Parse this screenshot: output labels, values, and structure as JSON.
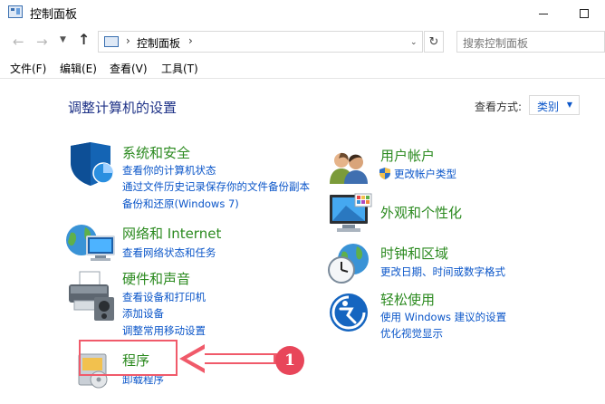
{
  "window": {
    "title": "控制面板",
    "minimize_glyph": "",
    "maximize_glyph": ""
  },
  "address_bar": {
    "path": "控制面板",
    "separator": "›",
    "search_placeholder": "搜索控制面板"
  },
  "menu": {
    "file": "文件(F)",
    "edit": "编辑(E)",
    "view": "查看(V)",
    "tools": "工具(T)"
  },
  "page": {
    "heading": "调整计算机的设置",
    "view_by_label": "查看方式:",
    "view_by_value": "类别"
  },
  "categories": {
    "security": {
      "title": "系统和安全",
      "links": [
        "查看你的计算机状态",
        "通过文件历史记录保存你的文件备份副本",
        "备份和还原(Windows 7)"
      ]
    },
    "network": {
      "title": "网络和 Internet",
      "links": [
        "查看网络状态和任务"
      ]
    },
    "hardware": {
      "title": "硬件和声音",
      "links": [
        "查看设备和打印机",
        "添加设备",
        "调整常用移动设置"
      ]
    },
    "programs": {
      "title": "程序",
      "links": [
        "卸载程序"
      ]
    },
    "users": {
      "title": "用户帐户",
      "links": [
        "更改帐户类型"
      ]
    },
    "appearance": {
      "title": "外观和个性化",
      "links": []
    },
    "clock": {
      "title": "时钟和区域",
      "links": [
        "更改日期、时间或数字格式"
      ]
    },
    "ease": {
      "title": "轻松使用",
      "links": [
        "使用 Windows 建议的设置",
        "优化视觉显示"
      ]
    }
  },
  "annotation": {
    "step_number": "1",
    "color": "#e8465a"
  },
  "colors": {
    "heading": "#1e3287",
    "category_title": "#2b8a1f",
    "link": "#0b56c9"
  }
}
